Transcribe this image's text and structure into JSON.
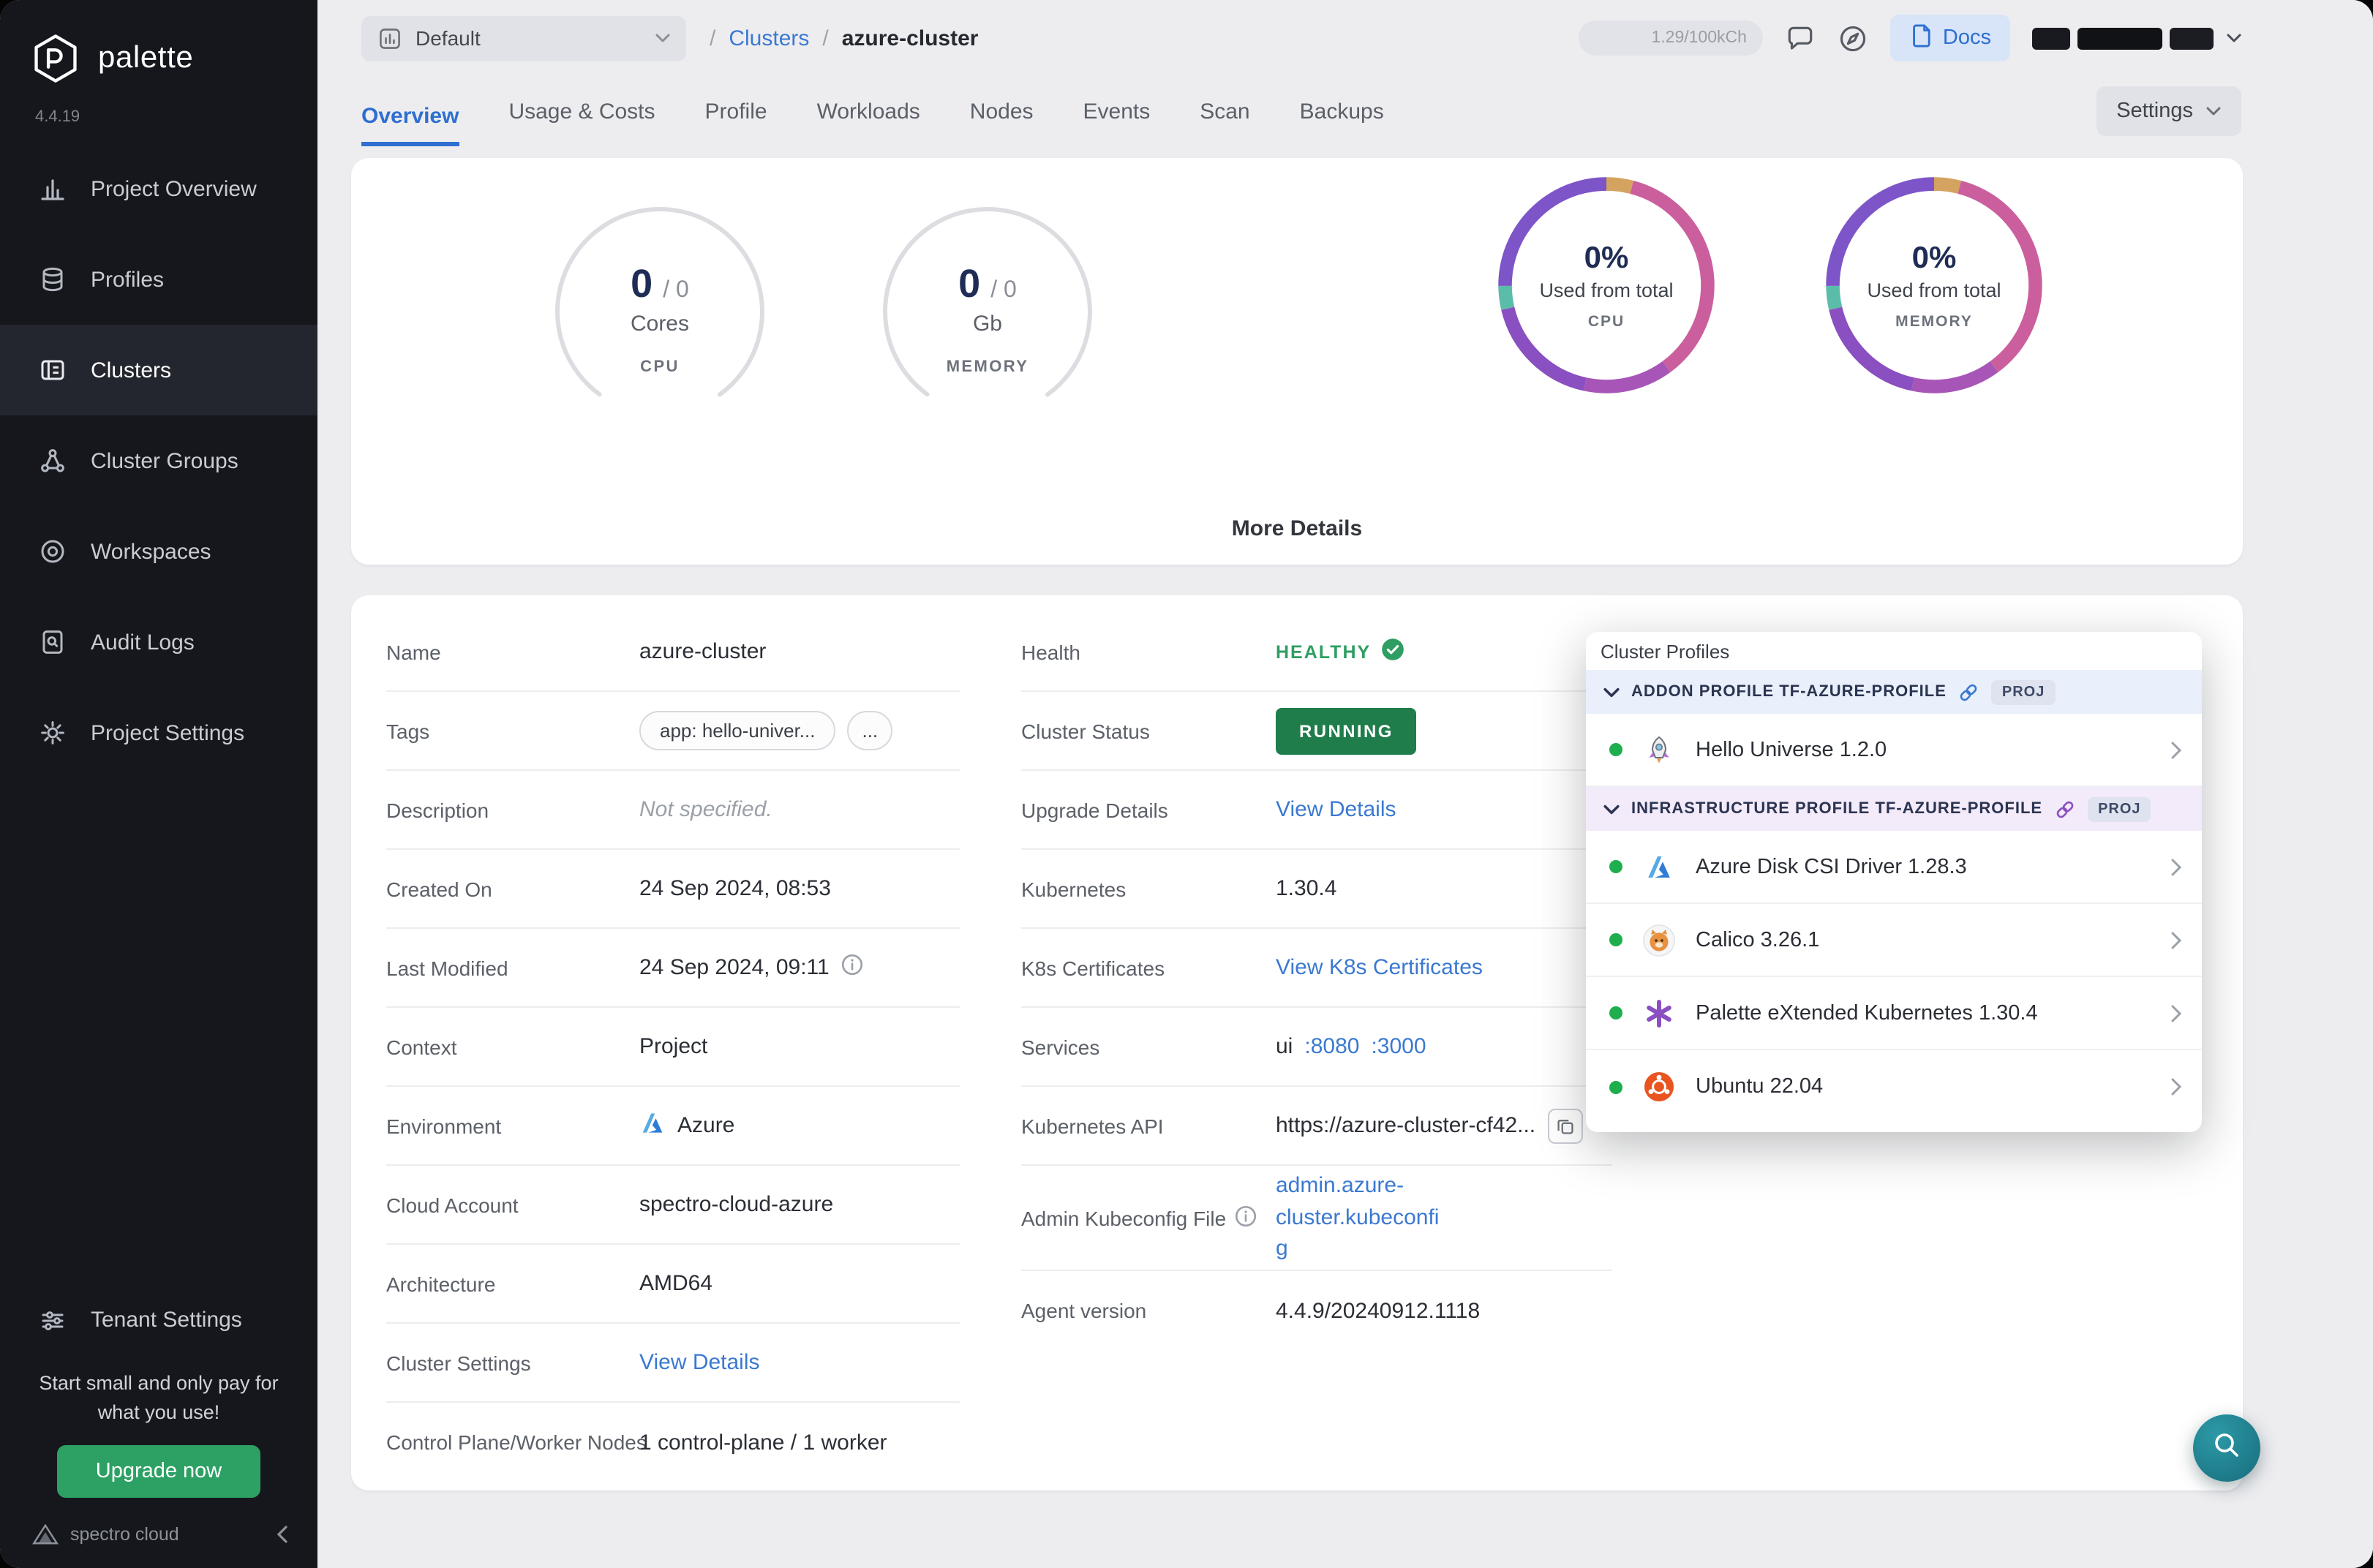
{
  "colors": {
    "accent_blue": "#2e6fd0",
    "sidebar_bg": "#15171d",
    "healthy_green": "#2f9e63",
    "running_green": "#1e7d4b",
    "upgrade_green": "#2da164",
    "donut_purple": "#8a4fc0",
    "donut_pink": "#cb5f9e",
    "fab_teal": "#1f7f8c"
  },
  "sidebar": {
    "brand": "palette",
    "version": "4.4.19",
    "items": [
      {
        "label": "Project Overview",
        "icon": "bar-chart-icon"
      },
      {
        "label": "Profiles",
        "icon": "layers-icon"
      },
      {
        "label": "Clusters",
        "icon": "cluster-list-icon",
        "active": true
      },
      {
        "label": "Cluster Groups",
        "icon": "cluster-groups-icon"
      },
      {
        "label": "Workspaces",
        "icon": "workspaces-icon"
      },
      {
        "label": "Audit Logs",
        "icon": "audit-logs-icon"
      },
      {
        "label": "Project Settings",
        "icon": "gear-icon"
      }
    ],
    "tenant_settings": "Tenant Settings",
    "promo_text": "Start small and only pay for what you use!",
    "upgrade_button": "Upgrade now",
    "footer_brand": "spectro cloud"
  },
  "topbar": {
    "project_selector": "Default",
    "breadcrumb_separator": "/",
    "breadcrumb_section": "Clusters",
    "breadcrumb_current": "azure-cluster",
    "usage": "1.29/100kCh",
    "docs_button": "Docs"
  },
  "tabs": {
    "items": [
      "Overview",
      "Usage & Costs",
      "Profile",
      "Workloads",
      "Nodes",
      "Events",
      "Scan",
      "Backups"
    ],
    "active": "Overview",
    "settings_button": "Settings"
  },
  "metrics": {
    "gauges": [
      {
        "value": "0",
        "total": "/ 0",
        "unit": "Cores",
        "label": "CPU"
      },
      {
        "value": "0",
        "total": "/ 0",
        "unit": "Gb",
        "label": "MEMORY"
      }
    ],
    "donuts": [
      {
        "percent": "0%",
        "caption": "Used from total",
        "label": "CPU"
      },
      {
        "percent": "0%",
        "caption": "Used from total",
        "label": "MEMORY"
      }
    ],
    "more_details_button": "More Details"
  },
  "details": {
    "left": {
      "name": {
        "label": "Name",
        "value": "azure-cluster"
      },
      "tags": {
        "label": "Tags",
        "pill": "app: hello-univer...",
        "more": "..."
      },
      "description": {
        "label": "Description",
        "value": "Not specified."
      },
      "created_on": {
        "label": "Created On",
        "value": "24 Sep 2024, 08:53"
      },
      "last_modified": {
        "label": "Last Modified",
        "value": "24 Sep 2024, 09:11"
      },
      "context": {
        "label": "Context",
        "value": "Project"
      },
      "environment": {
        "label": "Environment",
        "value": "Azure"
      },
      "cloud_account": {
        "label": "Cloud Account",
        "value": "spectro-cloud-azure"
      },
      "architecture": {
        "label": "Architecture",
        "value": "AMD64"
      },
      "cluster_settings": {
        "label": "Cluster Settings",
        "link": "View Details"
      },
      "nodes": {
        "label": "Control Plane/Worker Nodes",
        "value": "1 control-plane / 1 worker"
      }
    },
    "right": {
      "health": {
        "label": "Health",
        "value": "HEALTHY"
      },
      "cluster_status": {
        "label": "Cluster Status",
        "value": "RUNNING"
      },
      "upgrade_details": {
        "label": "Upgrade Details",
        "link": "View Details"
      },
      "kubernetes": {
        "label": "Kubernetes",
        "value": "1.30.4"
      },
      "k8s_certificates": {
        "label": "K8s Certificates",
        "link": "View K8s Certificates"
      },
      "services": {
        "label": "Services",
        "prefix": "ui",
        "port1": ":8080",
        "port2": ":3000"
      },
      "kubernetes_api": {
        "label": "Kubernetes API",
        "value": "https://azure-cluster-cf42..."
      },
      "admin_kubeconfig": {
        "label": "Admin Kubeconfig File",
        "link": "admin.azure-cluster.kubeconfig"
      },
      "agent_version": {
        "label": "Agent version",
        "value": "4.4.9/20240912.1118"
      }
    }
  },
  "cluster_profiles": {
    "title": "Cluster Profiles",
    "sections": [
      {
        "header": "ADDON PROFILE TF-AZURE-PROFILE",
        "badge": "PROJ",
        "items": [
          {
            "name": "Hello Universe 1.2.0",
            "icon": "hello-universe-icon"
          }
        ]
      },
      {
        "header": "INFRASTRUCTURE PROFILE TF-AZURE-PROFILE",
        "badge": "PROJ",
        "items": [
          {
            "name": "Azure Disk CSI Driver 1.28.3",
            "icon": "azure-icon"
          },
          {
            "name": "Calico 3.26.1",
            "icon": "calico-icon"
          },
          {
            "name": "Palette eXtended Kubernetes 1.30.4",
            "icon": "palette-k8s-icon"
          },
          {
            "name": "Ubuntu 22.04",
            "icon": "ubuntu-icon"
          }
        ]
      }
    ]
  }
}
